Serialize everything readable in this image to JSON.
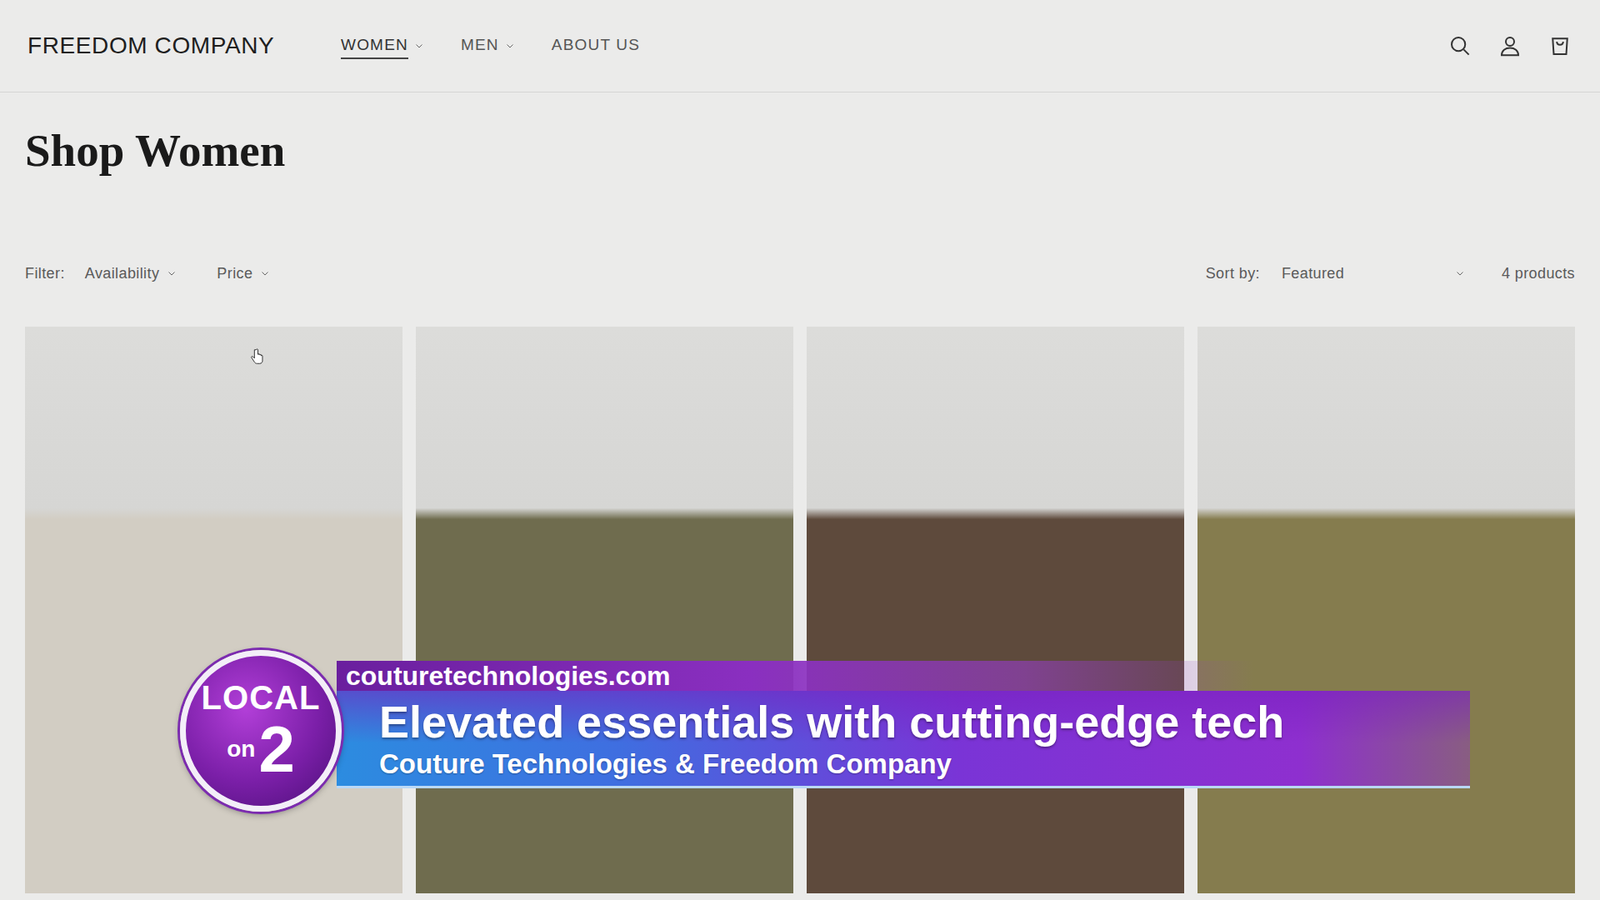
{
  "header": {
    "logo": "FREEDOM COMPANY",
    "nav": [
      {
        "label": "WOMEN",
        "selected": true,
        "kind": "dropdown"
      },
      {
        "label": "MEN",
        "selected": false,
        "kind": "dropdown"
      },
      {
        "label": "ABOUT US",
        "selected": false,
        "kind": "link"
      }
    ]
  },
  "page": {
    "title": "Shop Women"
  },
  "filters": {
    "label": "Filter:",
    "items": [
      "Availability",
      "Price"
    ]
  },
  "sort": {
    "label": "Sort by:",
    "value": "Featured",
    "count": "4 products"
  },
  "products": [
    {
      "color": "#d2cdc3"
    },
    {
      "color": "#6f6c4e"
    },
    {
      "color": "#5e4a3c"
    },
    {
      "color": "#857c4e"
    }
  ],
  "overlay": {
    "badge_top": "LOCAL",
    "badge_on": "on",
    "badge_num": "2",
    "url": "couturetechnologies.com",
    "headline": "Elevated essentials with cutting-edge tech",
    "subhead": "Couture Technologies & Freedom Company"
  }
}
